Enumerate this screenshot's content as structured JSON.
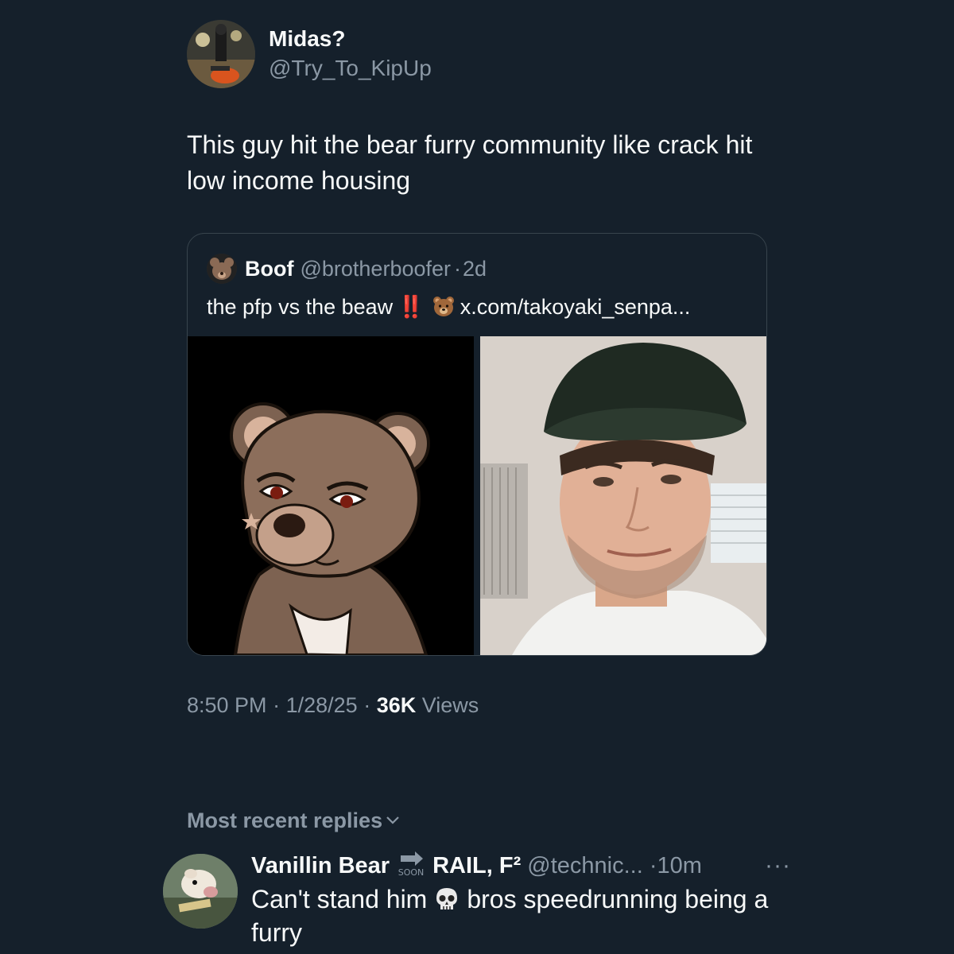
{
  "tweet": {
    "author_name": "Midas?",
    "author_handle": "@Try_To_KipUp",
    "text": "This guy hit the bear furry community like crack hit low income housing",
    "quote": {
      "author_name": "Boof",
      "author_handle": "@brotherboofer",
      "separator": "·",
      "age": "2d",
      "text_before": "the pfp vs the beaw",
      "bang_emoji": "‼️",
      "bear_emoji": "bear-face-emoji",
      "link": "x.com/takoyaki_senpa...",
      "images": [
        "bear-cartoon-pfp",
        "man-in-cap-selfie"
      ]
    },
    "time": "8:50 PM",
    "date": "1/28/25",
    "sep": "·",
    "views_count": "36K",
    "views_label": "Views"
  },
  "replies": {
    "sort_label": "Most recent replies",
    "items": [
      {
        "author_name_a": "Vanillin Bear",
        "soon_badge": "SOON",
        "author_name_b": "RAIL, F²",
        "author_handle": "@technic...",
        "sep": "·",
        "age": "10m",
        "more": "···",
        "text_before": "Can't stand him",
        "emoji": "skull-emoji",
        "text_after": "bros speedrunning being a furry"
      }
    ]
  },
  "colors": {
    "background": "#15202b",
    "text_primary": "#f7f9f9",
    "text_secondary": "#8b98a5",
    "border": "#38444d"
  }
}
